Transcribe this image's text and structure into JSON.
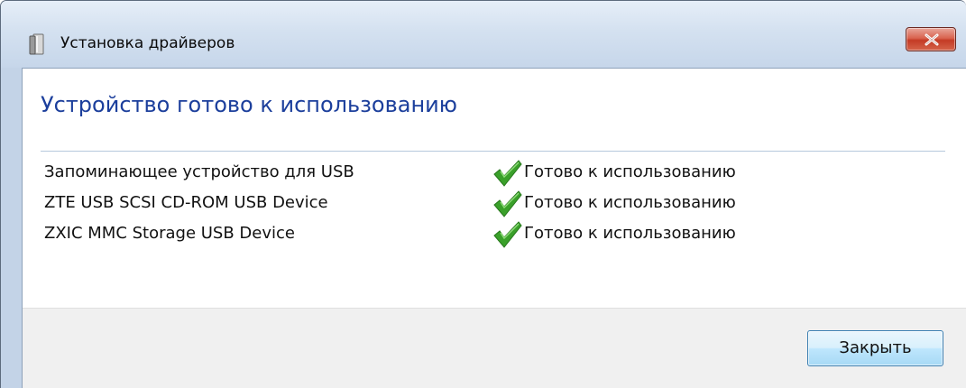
{
  "window": {
    "title": "Установка драйверов",
    "close_icon": "close-icon"
  },
  "main": {
    "heading": "Устройство готово к использованию",
    "devices": [
      {
        "name": "Запоминающее устройство для USB",
        "status": "Готово к использованию",
        "status_icon": "checkmark-icon"
      },
      {
        "name": "ZTE USB SCSI CD-ROM USB Device",
        "status": "Готово к использованию",
        "status_icon": "checkmark-icon"
      },
      {
        "name": "ZXIC MMC Storage USB Device",
        "status": "Готово к использованию",
        "status_icon": "checkmark-icon"
      }
    ]
  },
  "footer": {
    "close_label": "Закрыть"
  },
  "colors": {
    "heading": "#1c3f9c",
    "check": "#3aa02a",
    "close_button_red": "#c43b25"
  }
}
